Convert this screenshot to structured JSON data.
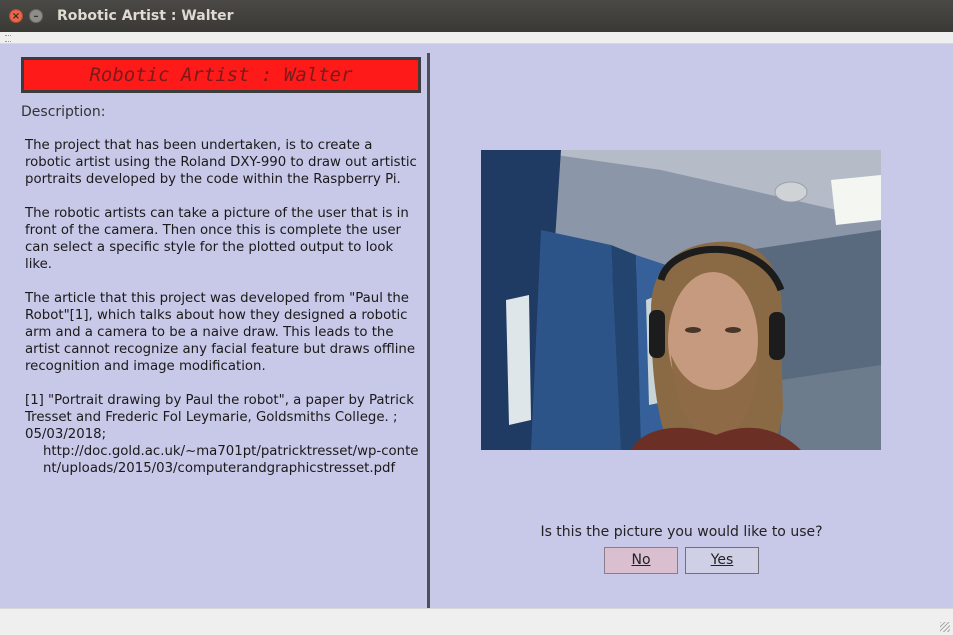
{
  "window": {
    "title": "Robotic Artist : Walter"
  },
  "left": {
    "header": "Robotic Artist : Walter",
    "description_label": "Description:",
    "paragraphs": [
      "The project that has been undertaken, is to create a robotic artist using the Roland DXY-990 to draw out artistic portraits developed by the code within the Raspberry Pi.",
      "The robotic artists can take a picture of the user that is in front of the camera. Then once this is complete the user can select a specific style for the plotted output to look like.",
      "The article that this project was developed from \"Paul the Robot\"[1], which talks about how they designed a robotic arm and a camera to be a naive draw. This leads to the artist cannot recognize any facial feature but draws offline recognition and image modification."
    ],
    "reference": "[1] \"Portrait drawing by Paul the robot\", a paper by Patrick Tresset and Frederic Fol Leymarie, Goldsmiths College. ; 05/03/2018;",
    "reference_url": "http://doc.gold.ac.uk/~ma701pt/patricktresset/wp-content/uploads/2015/03/computerandgraphicstresset.pdf"
  },
  "right": {
    "question": "Is this the picture you would like to use?",
    "no_label": "No",
    "yes_label": "Yes"
  },
  "colors": {
    "client_bg": "#c8c8e8",
    "header_red": "#ff1a1a",
    "no_button": "#d9bfd0"
  }
}
